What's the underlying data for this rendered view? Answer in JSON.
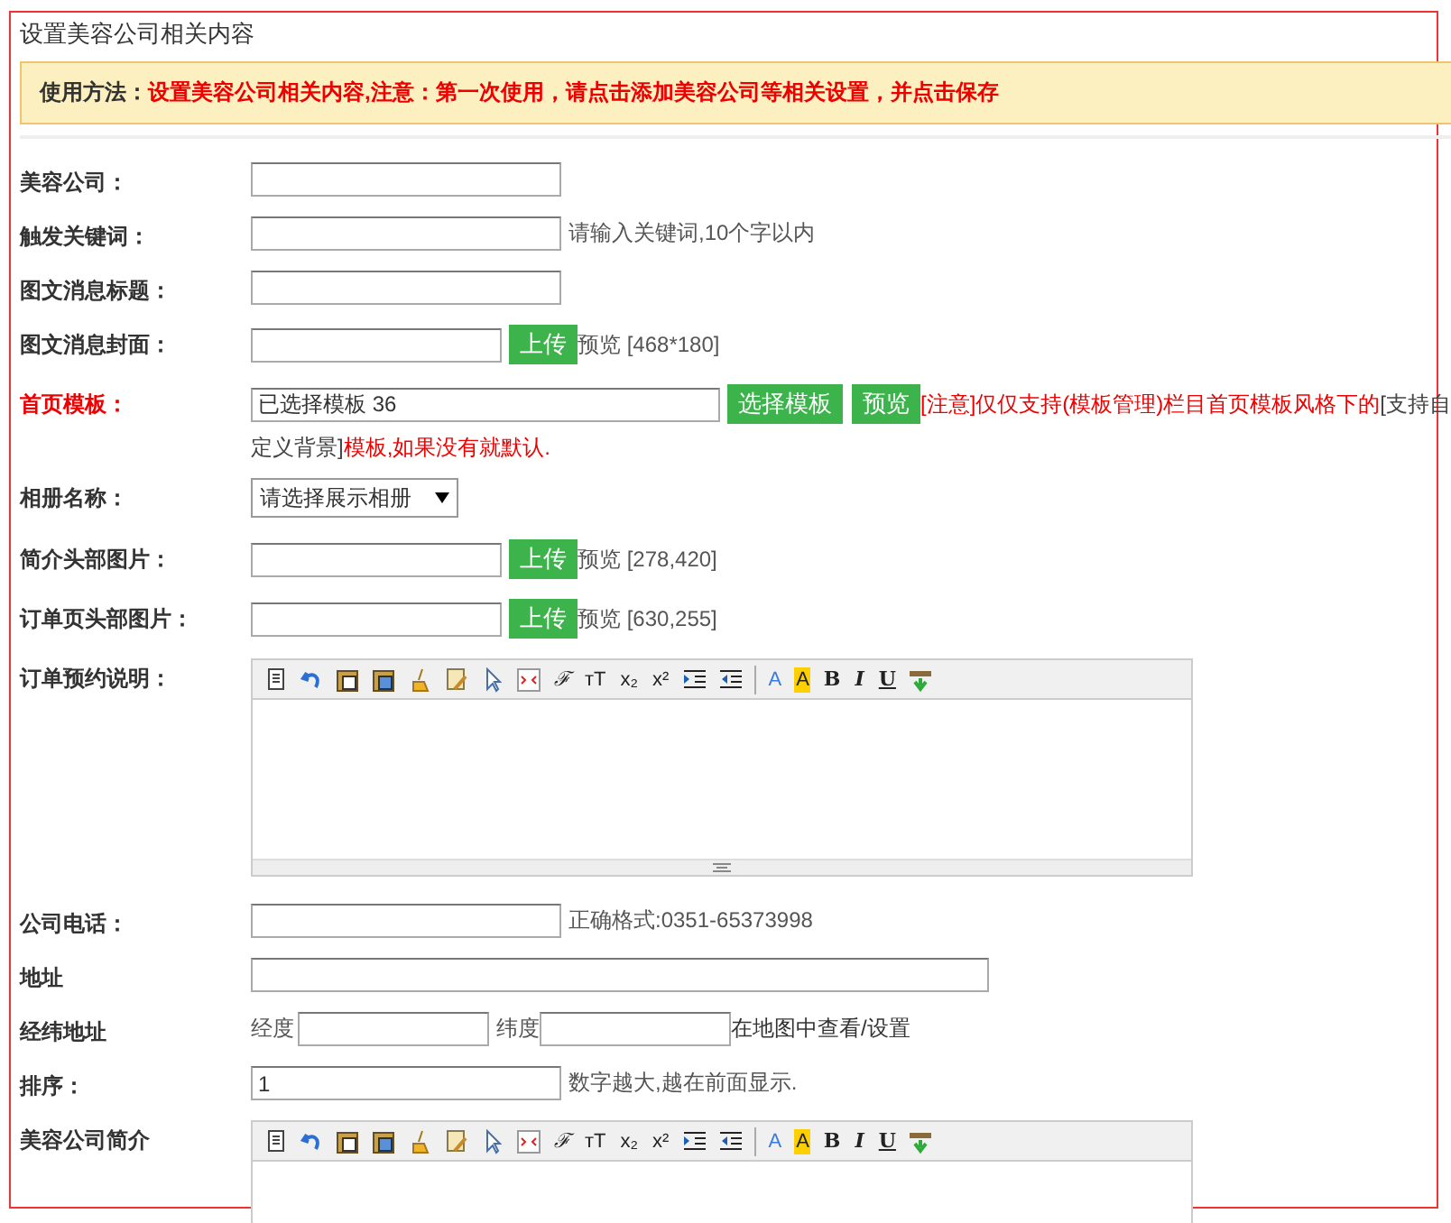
{
  "title": "设置美容公司相关内容",
  "notice": {
    "label": "使用方法：",
    "text": "设置美容公司相关内容,注意：第一次使用，请点击添加美容公司等相关设置，并点击保存"
  },
  "fields": [
    {
      "kind": "text",
      "label": "美容公司：",
      "highlight": false
    },
    {
      "kind": "text",
      "label": "触发关键词：",
      "highlight": false,
      "hint": "请输入关键词,10个字以内"
    },
    {
      "kind": "text",
      "label": "图文消息标题：",
      "highlight": false
    },
    {
      "kind": "upload",
      "label": "图文消息封面：",
      "highlight": false,
      "button": "上传",
      "preview": "预览 [468*180]"
    },
    {
      "kind": "template",
      "label": "首页模板：",
      "highlight": true,
      "value": "已选择模板 36",
      "buttons": [
        "选择模板",
        "预览"
      ],
      "note_lines": [
        [
          {
            "text": "[注意]仅仅支持(模板管理)栏目首页模板风格下的",
            "emphasis": true
          },
          {
            "text": "[支持自",
            "emphasis": false
          }
        ],
        [
          {
            "text": "定义背景]",
            "emphasis": false
          },
          {
            "text": "模板,如果没有就默认.",
            "emphasis": true
          }
        ]
      ]
    },
    {
      "kind": "select",
      "label": "相册名称：",
      "highlight": false,
      "value": "请选择展示相册"
    },
    {
      "kind": "upload",
      "label": "简介头部图片：",
      "highlight": false,
      "button": "上传",
      "preview": "预览 [278,420]"
    },
    {
      "kind": "upload",
      "label": "订单页头部图片：",
      "highlight": false,
      "button": "上传",
      "preview": "预览 [630,255]"
    },
    {
      "kind": "editor",
      "label": "订单预约说明：",
      "highlight": false,
      "resize_handle": true,
      "tools": [
        {
          "kind": "source"
        },
        {
          "kind": "undo"
        },
        {
          "kind": "paste-text"
        },
        {
          "kind": "paste-word"
        },
        {
          "kind": "clear"
        },
        {
          "kind": "format"
        },
        {
          "kind": "select"
        },
        {
          "kind": "page-break"
        },
        {
          "kind": "font",
          "glyph": "ℱ"
        },
        {
          "kind": "size",
          "glyph": "тT"
        },
        {
          "kind": "sub",
          "glyph": "x₂"
        },
        {
          "kind": "sup",
          "glyph": "x²"
        },
        {
          "kind": "indent"
        },
        {
          "kind": "outdent"
        },
        {
          "kind": "separator"
        },
        {
          "kind": "forecolor",
          "glyph": "A"
        },
        {
          "kind": "backcolor",
          "glyph": "A"
        },
        {
          "kind": "bold",
          "glyph": "B"
        },
        {
          "kind": "italic",
          "glyph": "I"
        },
        {
          "kind": "underline",
          "glyph": "U"
        },
        {
          "kind": "insert"
        }
      ]
    },
    {
      "kind": "text",
      "label": "公司电话：",
      "highlight": false,
      "hint": "正确格式:0351-65373998"
    },
    {
      "kind": "wide",
      "label": "地址",
      "highlight": false
    },
    {
      "kind": "geo",
      "label": "经纬地址",
      "highlight": false,
      "lng_label": "经度",
      "lat_label": "纬度",
      "link": "在地图中查看/设置"
    },
    {
      "kind": "text",
      "label": "排序：",
      "highlight": false,
      "value": "1",
      "hint": "数字越大,越在前面显示."
    },
    {
      "kind": "editor",
      "label": "美容公司简介",
      "highlight": false,
      "tools": [
        {
          "kind": "source"
        },
        {
          "kind": "undo"
        },
        {
          "kind": "paste-text"
        },
        {
          "kind": "paste-word"
        },
        {
          "kind": "clear"
        },
        {
          "kind": "format"
        },
        {
          "kind": "select"
        },
        {
          "kind": "page-break"
        },
        {
          "kind": "font",
          "glyph": "ℱ"
        },
        {
          "kind": "size",
          "glyph": "тT"
        },
        {
          "kind": "sub",
          "glyph": "x₂"
        },
        {
          "kind": "sup",
          "glyph": "x²"
        },
        {
          "kind": "indent"
        },
        {
          "kind": "outdent"
        },
        {
          "kind": "separator"
        },
        {
          "kind": "forecolor",
          "glyph": "A"
        },
        {
          "kind": "backcolor",
          "glyph": "A"
        },
        {
          "kind": "bold",
          "glyph": "B"
        },
        {
          "kind": "italic",
          "glyph": "I"
        },
        {
          "kind": "underline",
          "glyph": "U"
        },
        {
          "kind": "insert"
        }
      ]
    }
  ]
}
